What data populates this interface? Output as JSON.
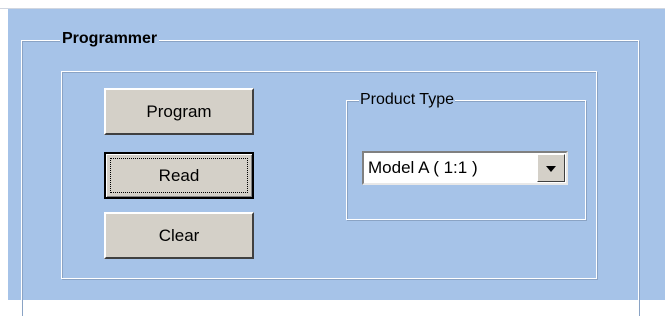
{
  "programmer": {
    "title": "Programmer",
    "buttons": {
      "program_label": "Program",
      "read_label": "Read",
      "clear_label": "Clear"
    },
    "product_type": {
      "title": "Product Type",
      "selected": "Model A ( 1:1 )"
    }
  },
  "colors": {
    "panel_background": "#a6c3e8",
    "button_face": "#d4d0c8"
  },
  "icons": {
    "dropdown": "chevron-down-icon"
  }
}
